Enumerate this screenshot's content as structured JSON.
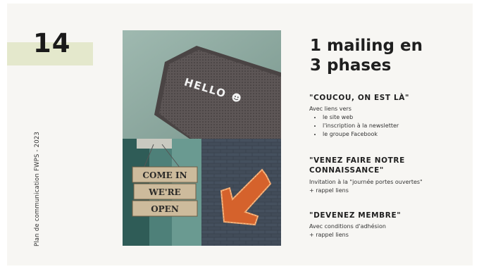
{
  "slide": {
    "number": "14",
    "side_label": "Plan de communication FWPS - 2023"
  },
  "title": {
    "line1": "1 mailing en",
    "line2": "3 phases"
  },
  "photos": {
    "hello_text": "HELLO",
    "comein_lines": [
      "COME IN",
      "WE'RE",
      "OPEN"
    ]
  },
  "sections": [
    {
      "heading": "\"COUCOU, ON EST LÀ\"",
      "lines": [
        "Avec liens vers"
      ],
      "bullets": [
        "le site web",
        "l'inscription à la newsletter",
        "le groupe Facebook"
      ]
    },
    {
      "heading_line1": "\"VENEZ FAIRE NOTRE",
      "heading_line2": "CONNAISSANCE\"",
      "lines": [
        "Invitation à la \"journée portes ouvertes\"",
        "+ rappel liens"
      ]
    },
    {
      "heading": "\"DEVENEZ MEMBRE\"",
      "lines": [
        "Avec conditions d'adhésion",
        "+ rappel liens"
      ]
    }
  ],
  "colors": {
    "background": "#f7f6f3",
    "accent_band": "#e4e8cc",
    "text": "#1f1f1f"
  }
}
